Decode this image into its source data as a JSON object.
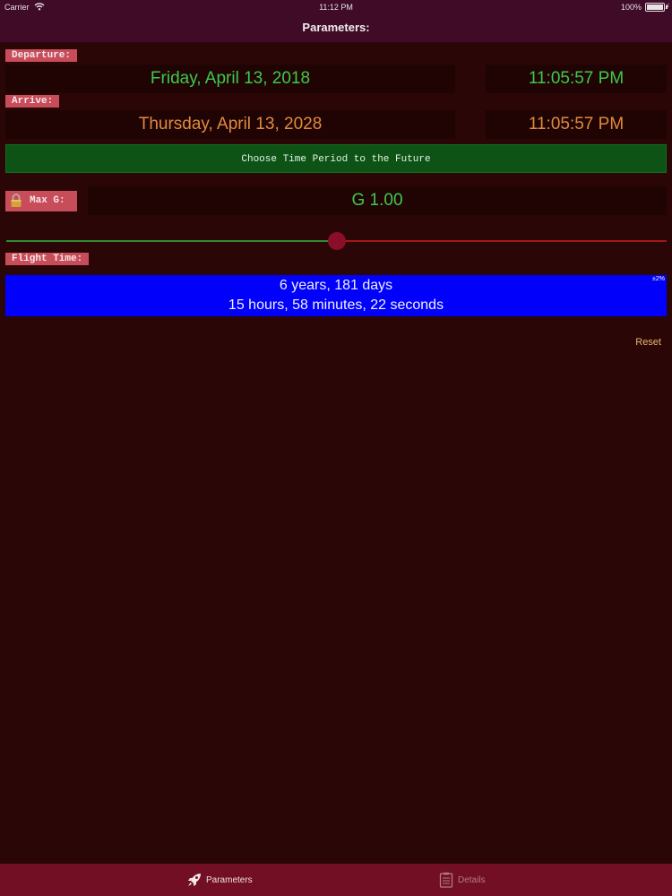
{
  "status_bar": {
    "carrier": "Carrier",
    "time": "11:12 PM",
    "battery": "100%"
  },
  "nav": {
    "title": "Parameters:"
  },
  "departure": {
    "label": "Departure:",
    "date": "Friday, April 13, 2018",
    "time": "11:05:57 PM"
  },
  "arrive": {
    "label": "Arrive:",
    "date": "Thursday, April 13, 2028",
    "time": "11:05:57 PM"
  },
  "choose_button": {
    "label": "Choose Time Period to the Future"
  },
  "max_g": {
    "label": "Max G:",
    "value": "G 1.00",
    "slider_position": 0.5
  },
  "flight_time": {
    "label": "Flight Time:",
    "line1": "6 years, 181 days",
    "line2": "15 hours, 58 minutes, 22 seconds",
    "accuracy": "±2%"
  },
  "reset": {
    "label": "Reset"
  },
  "tabs": [
    {
      "label": "Parameters",
      "icon": "rocket-icon",
      "selected": true
    },
    {
      "label": "Details",
      "icon": "document-icon",
      "selected": false
    }
  ],
  "colors": {
    "background": "#2a0606",
    "bar": "#3f0b27",
    "tag": "#c84d5a",
    "green_text": "#3ec94a",
    "orange_text": "#e08a3c",
    "choose_button": "#0c5315",
    "flight_box": "#0000fb",
    "tabbar": "#720f24",
    "slider_thumb": "#8a0e28"
  }
}
